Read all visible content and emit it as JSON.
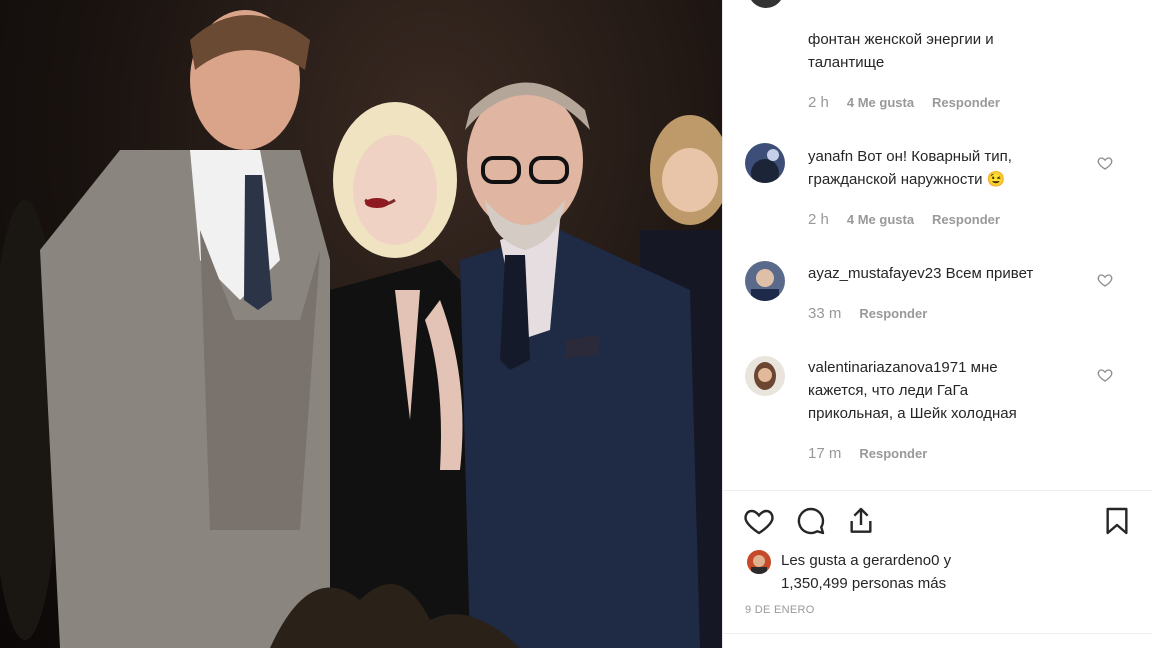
{
  "comments": [
    {
      "username": "",
      "text_line1": "фонтан женской энергии и",
      "text_line2": "талантище",
      "time": "2 h",
      "likes": "4 Me gusta",
      "reply": "Responder"
    },
    {
      "username": "yanafn",
      "text_line1": "Вот он! Коварный тип,",
      "text_line2": "гражданской наружности 😉",
      "time": "2 h",
      "likes": "4 Me gusta",
      "reply": "Responder"
    },
    {
      "username": "ayaz_mustafayev23",
      "text_line1": "Всем привет",
      "time": "33 m",
      "reply": "Responder"
    },
    {
      "username": "valentinariazanova1971",
      "text_line1": "мне",
      "text_line2": "кажется, что леди ГаГа",
      "text_line3": "прикольная, а Шейк холодная",
      "time": "17 m",
      "reply": "Responder"
    }
  ],
  "likes_summary": {
    "line1": "Les gusta a gerardeno0 y",
    "line2": "1,350,499 personas más"
  },
  "date": "9 DE ENERO",
  "icons": {
    "like": "heart-icon",
    "comment": "comment-icon",
    "share": "share-icon",
    "save": "bookmark-icon"
  },
  "colors": {
    "text": "#262626",
    "muted": "#999999"
  }
}
